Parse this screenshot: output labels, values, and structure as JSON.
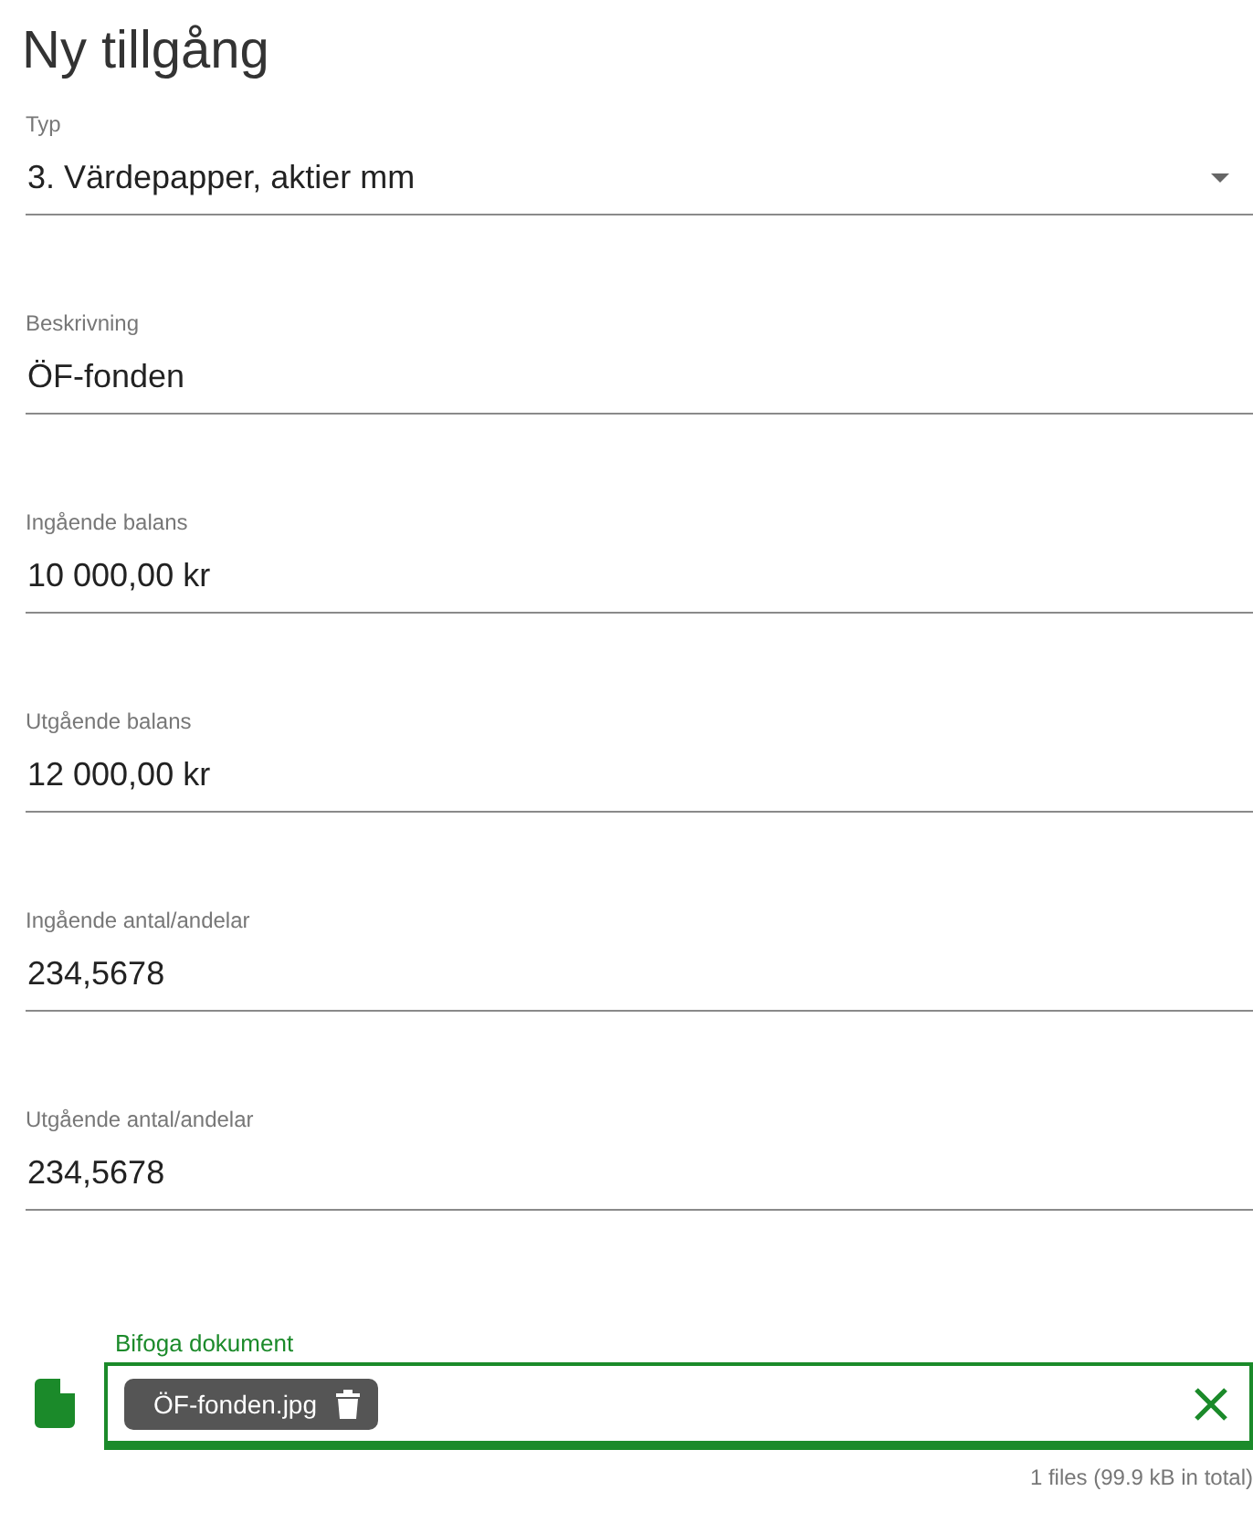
{
  "title": "Ny tillgång",
  "fields": [
    {
      "kind": "select",
      "label": "Typ",
      "value": "3. Värdepapper, aktier mm"
    },
    {
      "kind": "text",
      "label": "Beskrivning",
      "value": "ÖF-fonden"
    },
    {
      "kind": "text",
      "label": "Ingående balans",
      "value": "10 000,00 kr"
    },
    {
      "kind": "text",
      "label": "Utgående balans",
      "value": "12 000,00 kr"
    },
    {
      "kind": "text",
      "label": "Ingående antal/andelar",
      "value": "234,5678"
    },
    {
      "kind": "text",
      "label": "Utgående antal/andelar",
      "value": "234,5678"
    }
  ],
  "attachment": {
    "label": "Bifoga dokument",
    "focused": true,
    "files": [
      {
        "name": "ÖF-fonden.jpg"
      }
    ],
    "summary": "1 files (99.9 kB in total)"
  }
}
